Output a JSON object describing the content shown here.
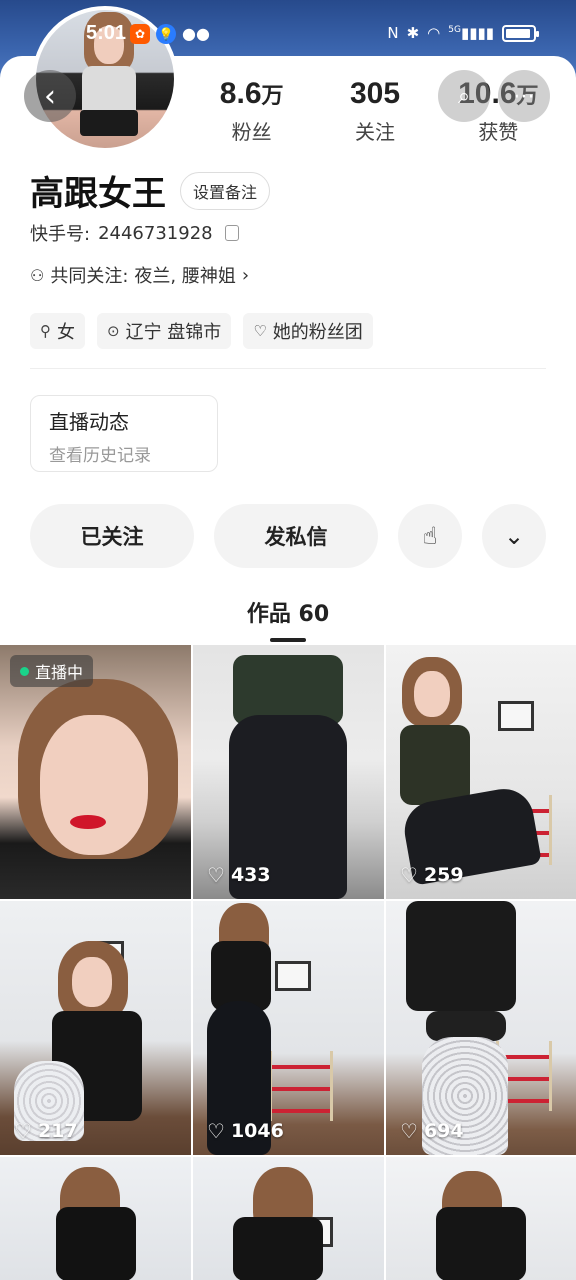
{
  "status_bar": {
    "time": "5:01",
    "app_icons": [
      "kuaishou-icon",
      "lightbulb-icon",
      "wechat-icon"
    ],
    "right_icons": [
      "nfc-icon",
      "bluetooth-icon",
      "wifi-icon",
      "signal-5g-icon",
      "battery-icon"
    ],
    "network_label": "5G"
  },
  "profile": {
    "name": "高跟女王",
    "remark_button": "设置备注",
    "id_label": "快手号:",
    "id_value": "2446731928",
    "mutual_label": "共同关注:",
    "mutual_names": "夜兰, 腰神姐",
    "stats": [
      {
        "value": "8.6",
        "unit": "万",
        "label": "粉丝"
      },
      {
        "value": "305",
        "unit": "",
        "label": "关注"
      },
      {
        "value": "10.6",
        "unit": "万",
        "label": "获赞"
      }
    ],
    "tags": [
      {
        "icon": "female-icon",
        "text": "女"
      },
      {
        "icon": "location-icon",
        "text": "辽宁 盘锦市"
      },
      {
        "icon": "fan-group-icon",
        "text": "她的粉丝团"
      }
    ]
  },
  "live_card": {
    "title": "直播动态",
    "subtitle": "查看历史记录"
  },
  "actions": {
    "follow_label": "已关注",
    "message_label": "发私信",
    "gift_icon": "tap-hand-icon",
    "more_icon": "chevron-down-icon"
  },
  "works_tab": {
    "label": "作品 60"
  },
  "grid": [
    {
      "badge": "直播中",
      "count": ""
    },
    {
      "badge": "",
      "count": "433"
    },
    {
      "badge": "",
      "count": "259"
    },
    {
      "badge": "",
      "count": "217"
    },
    {
      "badge": "",
      "count": "1046"
    },
    {
      "badge": "",
      "count": "694"
    },
    {
      "badge": "",
      "count": ""
    },
    {
      "badge": "",
      "count": ""
    },
    {
      "badge": "",
      "count": ""
    }
  ],
  "colors": {
    "header_blue": "#3a64ad",
    "live_dot": "#19d38a",
    "kuaishou_orange": "#ff5a00"
  }
}
